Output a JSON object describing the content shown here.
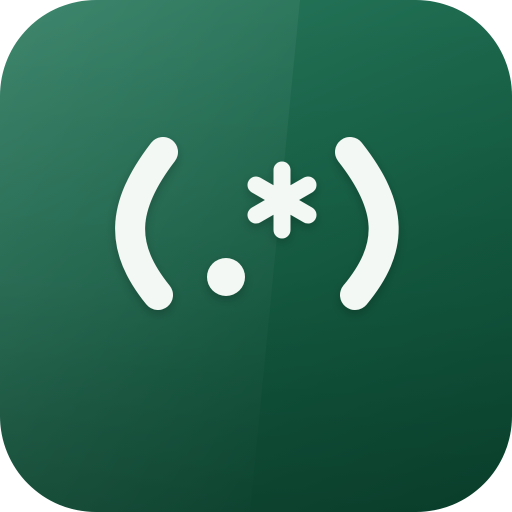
{
  "app_icon": {
    "symbol": "(.*)",
    "glyph_color": "#f3f8f4",
    "background_color_top": "#2a7a5e",
    "background_color_bottom": "#0b4a33",
    "glyphs": [
      "open-paren-icon",
      "dot-icon",
      "asterisk-icon",
      "close-paren-icon"
    ]
  }
}
